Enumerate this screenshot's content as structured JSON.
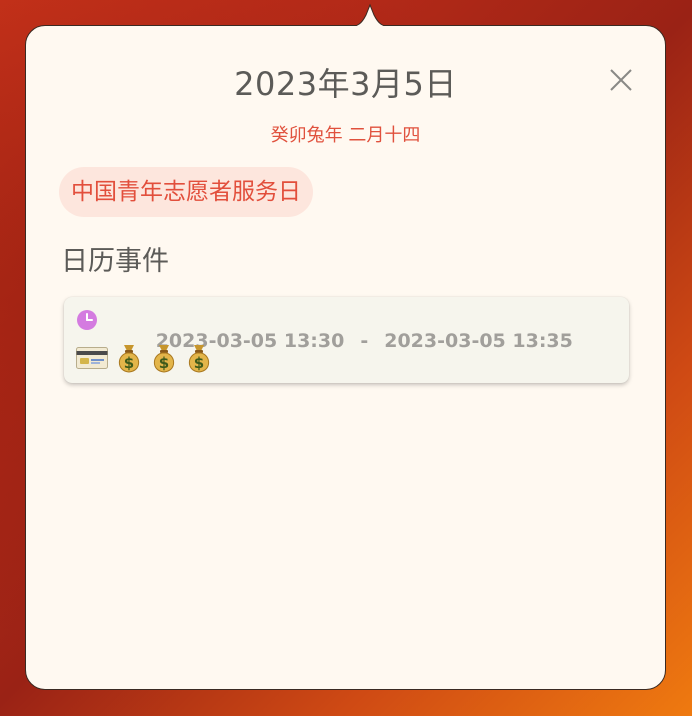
{
  "popover": {
    "title": "2023年3月5日",
    "lunar": "癸卯兔年 二月十四",
    "festival": "中国青年志愿者服务日",
    "section_title": "日历事件",
    "close_icon": "close-icon"
  },
  "event": {
    "start": "2023-03-05 13:30",
    "separator": "-",
    "end": "2023-03-05 13:35",
    "icons": [
      "credit-card-icon",
      "money-bag-icon",
      "money-bag-icon",
      "money-bag-icon"
    ],
    "clock_color": "#d47be0"
  },
  "colors": {
    "accent": "#e0513d",
    "festival_bg": "#fde6dd",
    "panel_bg": "#fff9f1"
  }
}
